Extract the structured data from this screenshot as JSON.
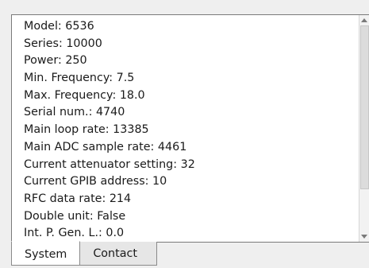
{
  "info": {
    "lines": [
      "Model: 6536",
      "Series: 10000",
      "Power: 250",
      "Min. Frequency: 7.5",
      "Max. Frequency: 18.0",
      "Serial num.: 4740",
      "Main loop rate: 13385",
      "Main ADC sample rate: 4461",
      "Current attenuator setting: 32",
      "Current GPIB address: 10",
      "RFC data rate: 214",
      "Double unit: False",
      "Int. P. Gen. L.: 0.0"
    ]
  },
  "tabs": [
    {
      "label": "System",
      "active": true
    },
    {
      "label": "Contact",
      "active": false
    }
  ]
}
